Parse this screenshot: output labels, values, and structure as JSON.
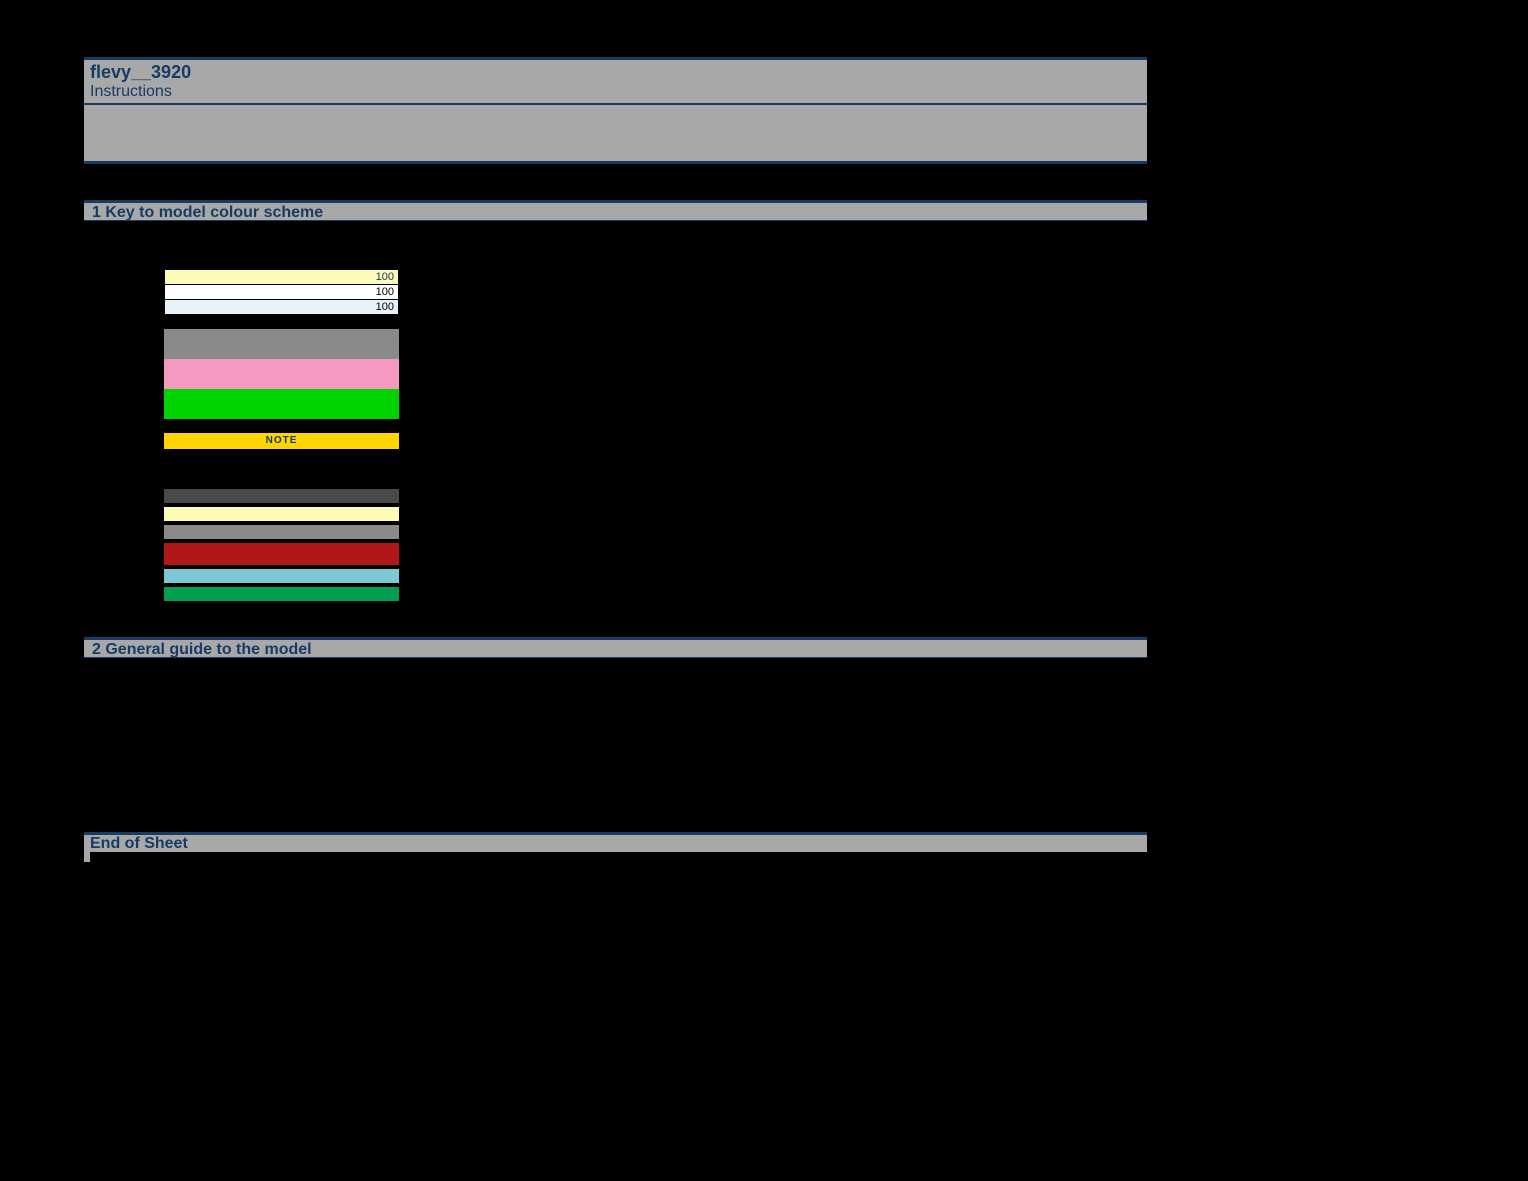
{
  "header": {
    "title": "flevy__3920",
    "subtitle": "Instructions"
  },
  "section1": {
    "heading": "1 Key to model colour scheme",
    "rows": [
      {
        "value": "100",
        "bg": "#fdfbb5",
        "valcolor": "blue"
      },
      {
        "value": "100",
        "bg": "#ffffff",
        "valcolor": "black"
      },
      {
        "value": "100",
        "bg": "#e8f3f9",
        "valcolor": "black"
      }
    ],
    "big_swatches": [
      {
        "bg": "#8a8a8a"
      },
      {
        "bg": "#f49ac1"
      },
      {
        "bg": "#00d400"
      }
    ],
    "note_label": "NOTE",
    "bars": [
      {
        "bg": "#4a4a4a",
        "h": "short"
      },
      {
        "bg": "#fdfbb5",
        "h": "short"
      },
      {
        "bg": "#8a8a8a",
        "h": "short"
      },
      {
        "bg": "#b01818",
        "h": "tall"
      },
      {
        "bg": "#7ec8d6",
        "h": "short"
      },
      {
        "bg": "#00a050",
        "h": "short"
      }
    ]
  },
  "section2": {
    "heading": "2 General guide to the model"
  },
  "footer": {
    "label": "End of Sheet"
  }
}
